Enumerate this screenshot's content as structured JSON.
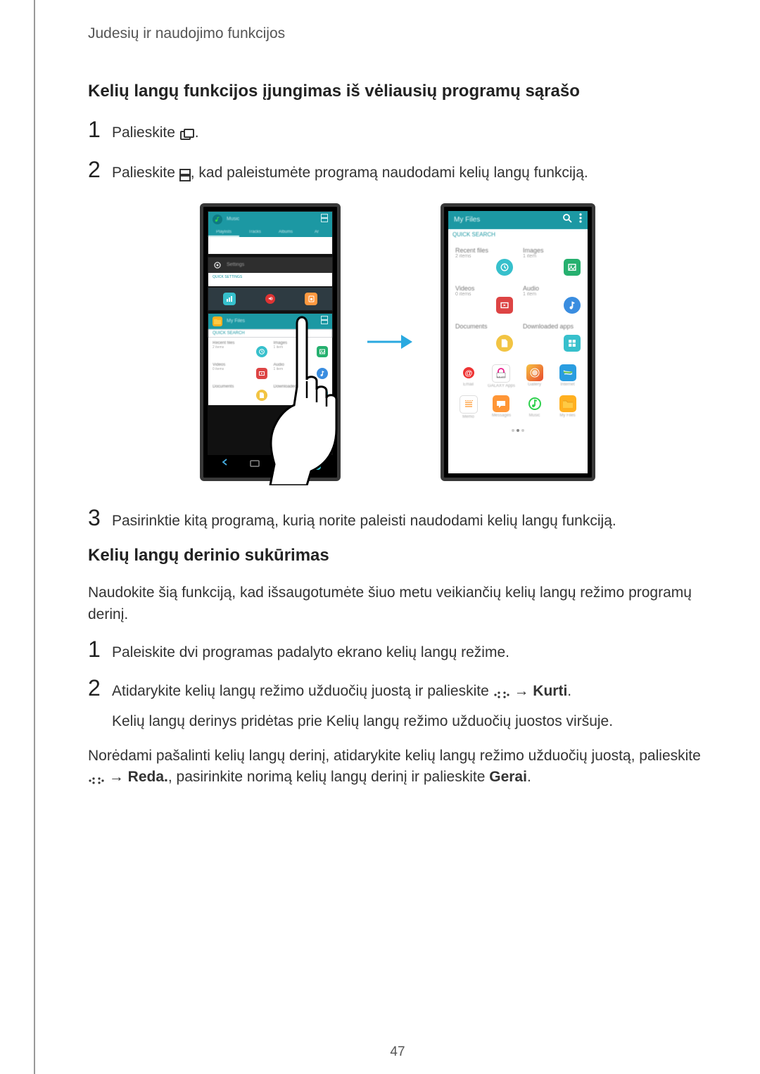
{
  "breadcrumb": "Judesių ir naudojimo funkcijos",
  "h2_1": "Kelių langų funkcijos įjungimas iš vėliausių programų sąrašo",
  "step1_1a": "Palieskite ",
  "step1_1b": ".",
  "step1_2a": "Palieskite ",
  "step1_2b": ", kad paleistumėte programą naudodami kelių langų funkciją.",
  "step1_3": "Pasirinktie kitą programą, kurią norite paleisti naudodami kelių langų funkciją.",
  "h2_2": "Kelių langų derinio sukūrimas",
  "p2": "Naudokite šią funkciją, kad išsaugotumėte šiuo metu veikiančių kelių langų režimo programų derinį.",
  "step2_1": "Paleiskite dvi programas padalyto ekrano kelių langų režime.",
  "step2_2a": "Atidarykite kelių langų režimo užduočių juostą ir palieskite ",
  "step2_2b": " → ",
  "step2_2c_bold": "Kurti",
  "step2_2d": ".",
  "step2_2_sub": "Kelių langų derinys pridėtas prie Kelių langų režimo užduočių juostos viršuje.",
  "p3a": "Norėdami pašalinti kelių langų derinį, atidarykite kelių langų režimo užduočių juostą, palieskite",
  "p3b": " → ",
  "p3c_bold": "Reda.",
  "p3d": ", pasirinkite norimą kelių langų derinį ir palieskite ",
  "p3e_bold": "Gerai",
  "p3f": ".",
  "page_num": "47",
  "fig": {
    "left": {
      "music": "Music",
      "playlists": "Playlists",
      "tracks": "Tracks",
      "albums": "Albums",
      "ar": "Ar",
      "settings": "Settings",
      "quicksettings": "QUICK SETTINGS",
      "myfiles": "My Files",
      "quicksearch": "QUICK SEARCH",
      "recentfiles": "Recent files",
      "images": "Images",
      "videos": "Videos",
      "audio": "Audio",
      "documents": "Documents",
      "downloaded": "Downloaded"
    },
    "right": {
      "title": "My Files",
      "quicksearch": "QUICK SEARCH",
      "recentfiles": "Recent files",
      "recentfiles_sub": "2 items",
      "images": "Images",
      "images_sub": "1 item",
      "videos": "Videos",
      "videos_sub": "0 items",
      "audio": "Audio",
      "audio_sub": "1 item",
      "documents": "Documents",
      "documents_sub": "",
      "downloaded": "Downloaded apps",
      "app1": "Email",
      "app2": "GALAXY Apps",
      "app3": "Gallery",
      "app4": "Internet",
      "app5": "Memo",
      "app6": "Messages",
      "app7": "Music",
      "app8": "My Files"
    }
  }
}
